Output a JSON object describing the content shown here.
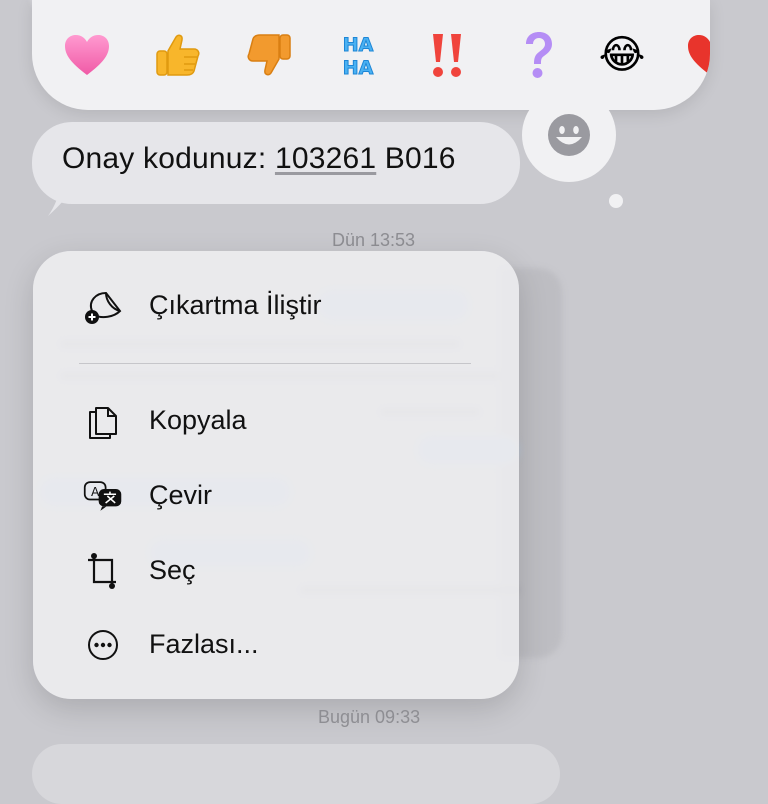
{
  "reactions": [
    {
      "name": "heart",
      "color": "#f66fb5"
    },
    {
      "name": "thumbs-up"
    },
    {
      "name": "thumbs-down"
    },
    {
      "name": "haha",
      "text_top": "HA",
      "text_bottom": "HA",
      "color": "#4ab1f2"
    },
    {
      "name": "exclamation",
      "text": "!!",
      "color": "#f0443c"
    },
    {
      "name": "question",
      "text": "?",
      "color": "#b58df5"
    },
    {
      "name": "laughing-face",
      "glyph": "😂"
    },
    {
      "name": "heart-partial",
      "color": "#e8342c"
    }
  ],
  "message": {
    "prefix": "Onay kodunuz: ",
    "code": "103261",
    "suffix": " B016"
  },
  "timestamps": {
    "yesterday": "Dün 13:53",
    "today": "Bugün 09:33"
  },
  "context_menu": {
    "items": [
      {
        "label": "Çıkartma İliştir"
      },
      {
        "label": "Kopyala"
      },
      {
        "label": "Çevir"
      },
      {
        "label": "Seç"
      },
      {
        "label": "Fazlası..."
      }
    ]
  }
}
